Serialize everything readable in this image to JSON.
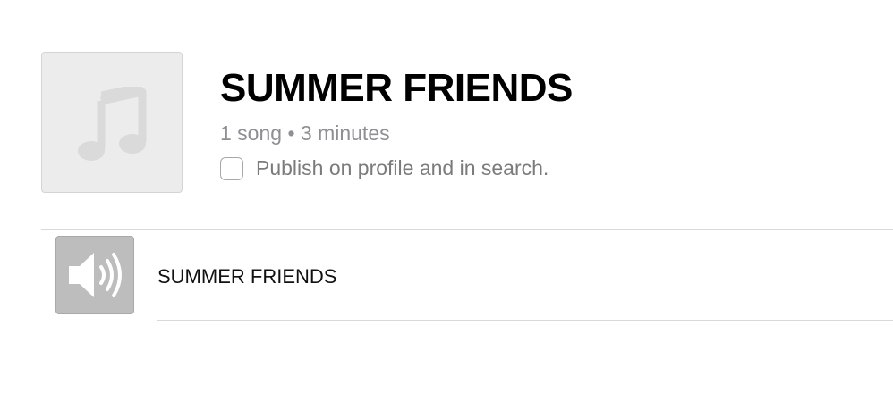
{
  "playlist": {
    "title": "SUMMER FRIENDS",
    "meta": "1 song • 3 minutes",
    "publish_label": "Publish on profile and in search.",
    "publish_checked": false,
    "artwork_icon": "music-note-icon"
  },
  "tracks": [
    {
      "title": "SUMMER FRIENDS",
      "icon": "speaker-icon"
    }
  ],
  "colors": {
    "title": "#000000",
    "meta": "#8e8e93",
    "artwork_bg": "#ececec",
    "track_art_bg": "#bdbdbd",
    "divider": "#d9d9d9"
  }
}
